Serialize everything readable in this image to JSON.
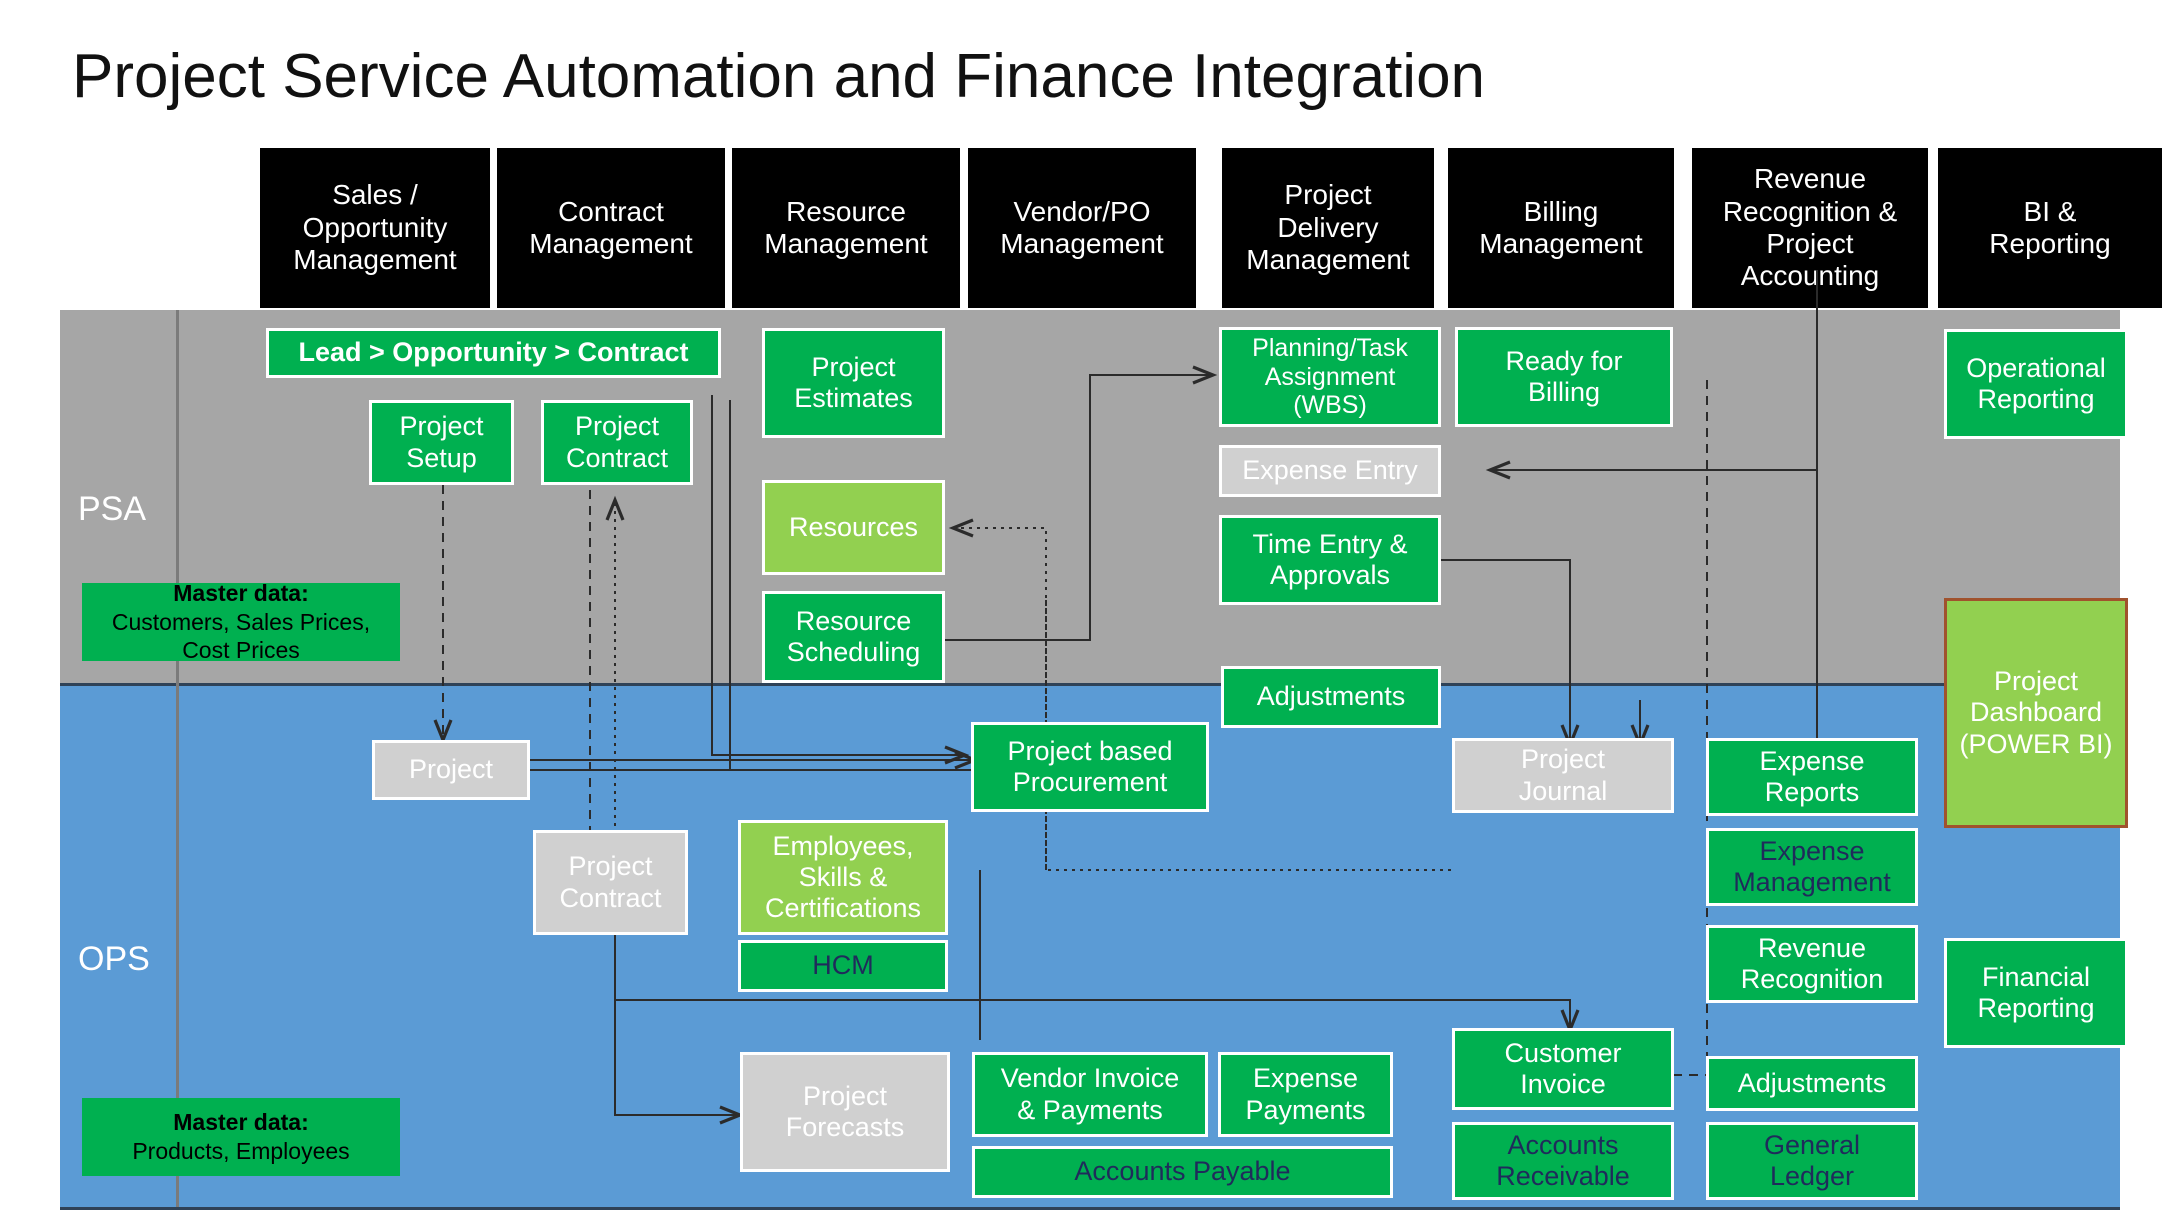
{
  "page": {
    "title": "Project Service Automation and Finance  Integration"
  },
  "colors": {
    "header_bg": "#000000",
    "psa_band": "#a6a6a6",
    "ops_band": "#5b9bd5",
    "green_dark": "#00b050",
    "green_light": "#92d050",
    "gray_box": "#d0d0d0",
    "navy_text": "#1f2b5b",
    "dashboard_border": "#a0522d"
  },
  "columns": [
    {
      "label": "Sales /\nOpportunity\nManagement"
    },
    {
      "label": "Contract\nManagement"
    },
    {
      "label": "Resource\nManagement"
    },
    {
      "label": "Vendor/PO\nManagement"
    },
    {
      "label": "Project\nDelivery\nManagement"
    },
    {
      "label": "Billing\nManagement"
    },
    {
      "label": "Revenue\nRecognition &\nProject\nAccounting"
    },
    {
      "label": "BI &\nReporting"
    }
  ],
  "bands": {
    "psa": {
      "label": "PSA"
    },
    "ops": {
      "label": "OPS"
    }
  },
  "psa_nodes": [
    {
      "id": "lead-opportunity-contract",
      "label": "Lead > Opportunity > Contract",
      "style": "green-dark"
    },
    {
      "id": "project-setup",
      "label": "Project\nSetup",
      "style": "green-dark"
    },
    {
      "id": "project-contract-psa",
      "label": "Project\nContract",
      "style": "green-dark"
    },
    {
      "id": "project-estimates",
      "label": "Project\nEstimates",
      "style": "green-dark"
    },
    {
      "id": "resources",
      "label": "Resources",
      "style": "green-light"
    },
    {
      "id": "resource-scheduling",
      "label": "Resource\nScheduling",
      "style": "green-dark"
    },
    {
      "id": "planning-task-assignment",
      "label": "Planning/Task\nAssignment\n(WBS)",
      "style": "green-dark"
    },
    {
      "id": "ready-for-billing",
      "label": "Ready for\nBilling",
      "style": "green-dark"
    },
    {
      "id": "expense-entry",
      "label": "Expense Entry",
      "style": "gray"
    },
    {
      "id": "time-entry-approvals",
      "label": "Time Entry &\nApprovals",
      "style": "green-dark"
    },
    {
      "id": "adjustments-psa",
      "label": "Adjustments",
      "style": "green-dark"
    },
    {
      "id": "operational-reporting",
      "label": "Operational\nReporting",
      "style": "green-dark"
    }
  ],
  "psa_master_data": {
    "heading": "Master data:",
    "body": "Customers, Sales Prices,\nCost Prices"
  },
  "ops_nodes": [
    {
      "id": "project",
      "label": "Project",
      "style": "gray"
    },
    {
      "id": "project-contract-ops",
      "label": "Project\nContract",
      "style": "gray"
    },
    {
      "id": "project-based-procurement",
      "label": "Project based\nProcurement",
      "style": "green-dark"
    },
    {
      "id": "employees-skills-certs",
      "label": "Employees,\nSkills &\nCertifications",
      "style": "green-light"
    },
    {
      "id": "hcm",
      "label": "HCM",
      "style": "green-dark-navy"
    },
    {
      "id": "project-journal",
      "label": "Project\nJournal",
      "style": "gray"
    },
    {
      "id": "expense-reports",
      "label": "Expense\nReports",
      "style": "green-dark"
    },
    {
      "id": "expense-management",
      "label": "Expense\nManagement",
      "style": "green-dark-navy"
    },
    {
      "id": "revenue-recognition",
      "label": "Revenue\nRecognition",
      "style": "green-dark"
    },
    {
      "id": "project-forecasts",
      "label": "Project\nForecasts",
      "style": "gray"
    },
    {
      "id": "vendor-invoice-payments",
      "label": "Vendor Invoice\n& Payments",
      "style": "green-dark"
    },
    {
      "id": "expense-payments",
      "label": "Expense\nPayments",
      "style": "green-dark"
    },
    {
      "id": "accounts-payable",
      "label": "Accounts Payable",
      "style": "green-dark-navy"
    },
    {
      "id": "customer-invoice",
      "label": "Customer\nInvoice",
      "style": "green-dark"
    },
    {
      "id": "adjustments-ops",
      "label": "Adjustments",
      "style": "green-dark"
    },
    {
      "id": "accounts-receivable",
      "label": "Accounts\nReceivable",
      "style": "green-dark-navy"
    },
    {
      "id": "general-ledger",
      "label": "General\nLedger",
      "style": "green-dark-navy"
    },
    {
      "id": "financial-reporting",
      "label": "Financial\nReporting",
      "style": "green-dark"
    }
  ],
  "ops_master_data": {
    "heading": "Master data:",
    "body": "Products, Employees"
  },
  "dashboard": {
    "id": "project-dashboard",
    "label": "Project\nDashboard\n(POWER BI)",
    "style": "green-light-brownborder"
  }
}
